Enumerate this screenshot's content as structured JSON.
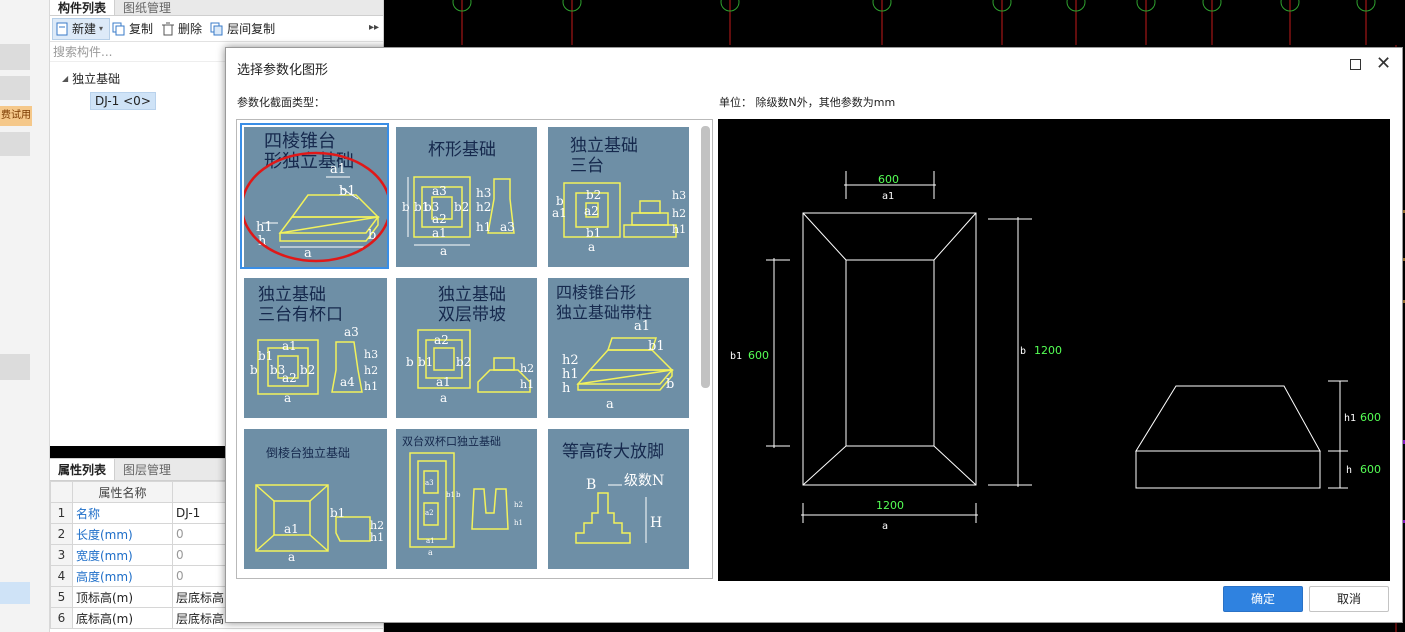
{
  "left_strip": {
    "trial_badge": "费试用"
  },
  "component_panel": {
    "tabs": [
      "构件列表",
      "图纸管理"
    ],
    "toolbar": {
      "new": "新建",
      "copy": "复制",
      "delete": "删除",
      "floor_copy": "层间复制"
    },
    "search_placeholder": "搜索构件...",
    "tree": {
      "group": "独立基础",
      "item": "DJ-1 <0>"
    }
  },
  "property_panel": {
    "tabs": [
      "属性列表",
      "图层管理"
    ],
    "header": "属性名称",
    "rows": [
      {
        "num": "1",
        "name": "名称",
        "value": "DJ-1"
      },
      {
        "num": "2",
        "name": "长度(mm)",
        "value": "0"
      },
      {
        "num": "3",
        "name": "宽度(mm)",
        "value": "0"
      },
      {
        "num": "4",
        "name": "高度(mm)",
        "value": "0"
      },
      {
        "num": "5",
        "name": "顶标高(m)",
        "value": "层底标高"
      },
      {
        "num": "6",
        "name": "底标高(m)",
        "value": "层底标高"
      }
    ]
  },
  "dialog": {
    "title": "选择参数化图形",
    "type_label": "参数化截面类型：",
    "unit_text": "单位：  除级数N外，其他参数为mm",
    "ok": "确定",
    "cancel": "取消",
    "shapes": [
      {
        "title1": "四棱锥台",
        "title2": "形独立基础",
        "labels": [
          "a1",
          "b1",
          "h1",
          "h",
          "a",
          "b"
        ]
      },
      {
        "title1": "杯形基础",
        "title2": "",
        "labels": [
          "a3",
          "a2",
          "a1",
          "a",
          "b",
          "b1",
          "b3",
          "b2",
          "h3",
          "h2",
          "h1",
          "a3"
        ]
      },
      {
        "title1": "独立基础",
        "title2": "三台",
        "labels": [
          "b2",
          "a2",
          "a1",
          "b1",
          "b",
          "a",
          "h3",
          "h2",
          "h1"
        ]
      },
      {
        "title1": "独立基础",
        "title2": "三台有杯口",
        "labels": [
          "a1",
          "a3",
          "a2",
          "b",
          "b1",
          "b3",
          "b2",
          "a",
          "h3",
          "h2",
          "h1",
          "a4"
        ]
      },
      {
        "title1": "独立基础",
        "title2": "双层带坡",
        "labels": [
          "a2",
          "a1",
          "a",
          "b",
          "b1",
          "b2",
          "h2",
          "h1"
        ]
      },
      {
        "title1": "四棱锥台形",
        "title2": "独立基础带柱",
        "labels": [
          "a1",
          "b1",
          "h2",
          "h1",
          "h",
          "a",
          "b"
        ]
      },
      {
        "title1": "倒棱台独立基础",
        "title2": "",
        "labels": [
          "a1",
          "b1",
          "a",
          "h2",
          "h1"
        ]
      },
      {
        "title1": "双台双杯口独立基础",
        "title2": "",
        "labels": [
          "a3",
          "a2",
          "a1",
          "a",
          "b1",
          "b",
          "h2",
          "h1"
        ]
      },
      {
        "title1": "等高砖大放脚",
        "title2": "",
        "labels": [
          "B",
          "级数N",
          "H"
        ]
      }
    ],
    "preview": {
      "a1_value": "600",
      "a1_label": "a1",
      "b1_label": "b1",
      "b1_value": "600",
      "b_label": "b",
      "b_value": "1200",
      "a_value": "1200",
      "a_label": "a",
      "h1_label": "h1",
      "h1_value": "600",
      "h_label": "h",
      "h_value": "600"
    }
  }
}
